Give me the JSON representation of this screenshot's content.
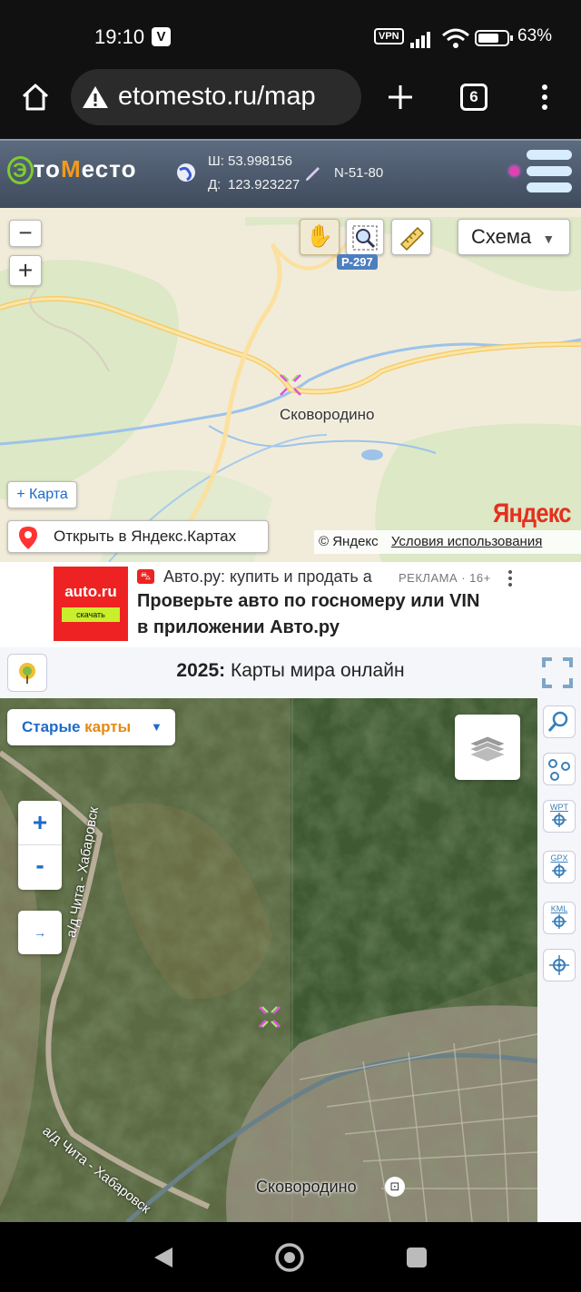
{
  "status": {
    "time": "19:10",
    "vpn": "VPN",
    "battery": "63%"
  },
  "browser": {
    "url": "etomesto.ru/map",
    "tabs_count": "6"
  },
  "etomesto": {
    "logo_e": "Э",
    "logo_to": "то",
    "logo_m": "М",
    "logo_esto": "есто",
    "lat_label": "Ш:",
    "lat": "53.998156",
    "lon_label": "Д:",
    "lon": "123.923227",
    "sheet": "N-51-80"
  },
  "ymap": {
    "zoom_out": "−",
    "zoom_in": "+",
    "layer_label": "Схема",
    "road_label": "Р-297",
    "city_label": "Сковородино",
    "add_map": "+ Карта",
    "open_in_yandex": "Открыть в Яндекс.Картах",
    "copyright": "© Яндекс",
    "terms": "Условия использования",
    "brand": "Яндекс"
  },
  "ad": {
    "logo": "auto.ru",
    "logo_button": "скачать",
    "source": "Авто.ру: купить и продать а",
    "label": "РЕКЛАМА · 16+",
    "title_line1": "Проверьте авто по госномеру или VIN",
    "title_line2": "в приложении Авто.ру"
  },
  "world": {
    "year": "2025:",
    "title": "Карты мира онлайн"
  },
  "sat": {
    "old_maps_1": "Старые",
    "old_maps_2": "карты",
    "zoom_in": "+",
    "zoom_out": "-",
    "arrow": "→",
    "road_label_1": "а/д Чита - Хабаровск",
    "road_label_2": "а/д Чита - Хабаровск",
    "city": "Сковородино"
  },
  "rightbar": {
    "wpt": "WPT",
    "gpx": "GPX",
    "kml": "KML"
  },
  "colors": {
    "browser_bg": "#111111",
    "header_bg": "#4f5c70",
    "logo_green": "#7ccd2f",
    "logo_orange": "#f39a1c",
    "old_maps_blue": "#1e6ac8",
    "old_maps_orange": "#e58a12",
    "yandex_red": "#e53020"
  }
}
